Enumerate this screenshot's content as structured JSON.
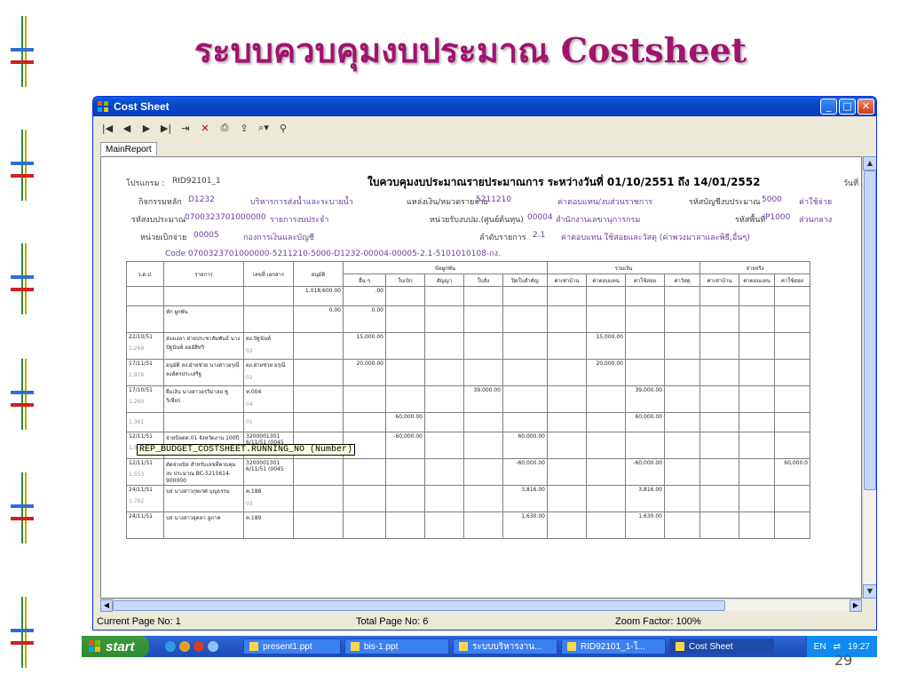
{
  "slide": {
    "title": "ระบบควบคุมงบประมาณ Costsheet",
    "page_number": "29"
  },
  "window": {
    "title": "Cost Sheet",
    "controls": [
      "minimize-icon",
      "maximize-icon",
      "close-icon"
    ]
  },
  "toolbar": {
    "icons": [
      "first-page-icon",
      "prev-page-icon",
      "next-page-icon",
      "last-page-icon",
      "goto-page-icon",
      "delete-icon",
      "print-icon",
      "export-icon",
      "zoom-icon",
      "binoculars-icon"
    ]
  },
  "tabs": [
    {
      "label": "MainReport"
    }
  ],
  "report": {
    "program_label": "โปรแกรม :",
    "program_value": "RID92101_1",
    "main_title": "ใบควบคุมงบประมาณรายประมาณการ ระหว่างวันที่ 01/10/2551 ถึง 14/01/2552",
    "date_label": "วันที่",
    "activity_label": "กิจกรรมหลัก",
    "activity_code": "D1232",
    "activity_name": "บริหารการส่งน้ำและระบายน้ำ",
    "source_label": "แหล่งเงิน/หมวดรายจ่าย",
    "source_code": "5211210",
    "source_name": "ค่าตอบแทน/งบส่วนราชการ",
    "account_label": "รหัสบัญชีงบประมาณ",
    "account_code": "5000",
    "account_name": "ค่าใช้จ่าย",
    "budget_code_label": "รหัสงบประมาณ",
    "budget_code": "0700323701000000",
    "budget_code_name": "รายการงบประจำ",
    "unit_label": "หน่วยรับงบปม.(ศูนย์ต้นทุน)",
    "unit_code": "00004",
    "unit_name": "สำนักงานเลขานุการกรม",
    "area_label": "รหัสพื้นที่",
    "area_code": "P1000",
    "area_name": "ส่วนกลาง",
    "payer_label": "หน่วยเบิกจ่าย",
    "payer_code": "00005",
    "payer_name": "กองการเงินและบัญชี",
    "seq_label": "ลำดับรายการ",
    "seq_value": "2.1",
    "seq_name": "ค่าตอบแทน ใช้สอยและวัสดุ (ค่าพวงมาลาและพิธี,อื่นๆ)",
    "code_line": "Code 0700323701000000-5211210-5000-D1232-00004-00005-2.1-5101010108-กง."
  },
  "table": {
    "headers_top": [
      "ว.ด.ป.",
      "รายการ",
      "เลขที่ เอกสาร",
      "อนุมัติ",
      "ข้อผูกพัน",
      "รวมเงิน",
      "จ่ายจริง"
    ],
    "headers_sub": [
      "อื่น ๆ",
      "ใบเบิก",
      "สัญญา",
      "ใบสั่ง",
      "ปิดใบสำคัญ",
      "ค่าเช่าบ้าน",
      "ค่าตอบแทน",
      "ค่าใช้สอย",
      "ค่าวัสดุ",
      "ค่าเช่าบ้าน",
      "ค่าตอบแทน",
      "ค่าใช้สอย"
    ],
    "rows": [
      {
        "date": "",
        "sub": "",
        "desc": "",
        "doc": "",
        "approve": "1,018,600.00",
        "c": [
          ".00",
          "",
          "",
          "",
          "",
          "",
          "",
          "",
          "",
          "",
          "",
          ""
        ]
      },
      {
        "date": "",
        "sub": "",
        "desc": "หัก ผูกพัน",
        "doc": "",
        "approve": "0.00",
        "c": [
          "0.00",
          "",
          "",
          "",
          "",
          "",
          "",
          "",
          "",
          "",
          "",
          ""
        ]
      },
      {
        "date": "22/10/51",
        "sub": "1,268",
        "desc": "ส่งงเงลา ฝ่ายประชาสัมพันธ์ นาง ปัฐนันท์ ลออัสิทวิ",
        "doc": "ตง.ปัฐนันท์",
        "docsub": "02",
        "approve": "",
        "c": [
          "15,000.00",
          "",
          "",
          "",
          "",
          "",
          "15,000.00",
          "",
          "",
          "",
          "",
          ""
        ]
      },
      {
        "date": "17/11/51",
        "sub": "1,978",
        "desc": "อนุมัติ ลง.ฝ่ายช่วย นางสาวอรุณี ลงอัครประเสริฐ",
        "doc": "ตง.ฝ่ายช่วย อรุณี",
        "docsub": "02",
        "approve": "",
        "c": [
          "20,000.00",
          "",
          "",
          "",
          "",
          "",
          "20,000.00",
          "",
          "",
          "",
          "",
          ""
        ]
      },
      {
        "date": "17/10/51",
        "sub": "1,260",
        "desc": "ยืมเงิน นางสาวอรวิมาลย ชูวิเชียร",
        "doc": "ท.004",
        "docsub": "04",
        "approve": "",
        "c": [
          "",
          "",
          "",
          "39,000.00",
          "",
          "",
          "",
          "39,000.00",
          "",
          "",
          "",
          ""
        ]
      },
      {
        "date": "",
        "sub": "1,361",
        "desc": "",
        "doc": "",
        "docsub": "01",
        "approve": "",
        "c": [
          "",
          "60,000.00",
          "",
          "",
          "",
          "",
          "",
          "60,000.00",
          "",
          "",
          "",
          ""
        ]
      },
      {
        "date": "12/11/51",
        "sub": "1,552",
        "desc": "จ่ายบิลตต.01 จังหวัดงาน 100ปี",
        "doc": "3200001301 6/11/51 (0045",
        "docsub": "",
        "approve": "",
        "c": [
          "",
          "-60,000.00",
          "",
          "",
          "60,000.00",
          "",
          "",
          "",
          "",
          "",
          "",
          ""
        ]
      },
      {
        "date": "12/11/51",
        "sub": "1,553",
        "desc": "ตัดจ่ายบิล สำหรับเลขที่ควบคุมงบ ประมาณ BC-5215614-900000",
        "doc": "3200001301 6/11/51 (0045",
        "docsub": "",
        "approve": "",
        "c": [
          "",
          "",
          "",
          "",
          "-60,000.00",
          "",
          "",
          "-60,000.00",
          "",
          "",
          "",
          "60,000.0"
        ]
      },
      {
        "date": "24/11/51",
        "sub": "1,782",
        "desc": "บส นางสาวกุพเรศ บุญธรรม",
        "doc": "ค.188",
        "docsub": "03",
        "approve": "",
        "c": [
          "",
          "",
          "",
          "",
          "3,816.00",
          "",
          "",
          "3,816.00",
          "",
          "",
          "",
          ""
        ]
      },
      {
        "date": "24/11/51",
        "sub": "",
        "desc": "บส นางสาวอุดลา ลูภาค",
        "doc": "ค.189",
        "docsub": "",
        "approve": "",
        "c": [
          "",
          "",
          "",
          "",
          "1,630.00",
          "",
          "",
          "1,630.00",
          "",
          "",
          "",
          ""
        ]
      }
    ]
  },
  "tooltip": "REP_BUDGET_COSTSHEET.RUNNING_NO (Number)",
  "status": {
    "current_page": "Current Page No: 1",
    "total_page": "Total Page No: 6",
    "zoom": "Zoom Factor: 100%"
  },
  "taskbar": {
    "start_label": "start",
    "items": [
      {
        "label": "present1.ppt",
        "active": false
      },
      {
        "label": "bis-1.ppt",
        "active": false
      },
      {
        "label": "ระบบบริหารงาน...",
        "active": false
      },
      {
        "label": "RID92101_1-ใ...",
        "active": false
      },
      {
        "label": "Cost Sheet",
        "active": true
      }
    ],
    "lang": "EN",
    "time": "19:27"
  }
}
